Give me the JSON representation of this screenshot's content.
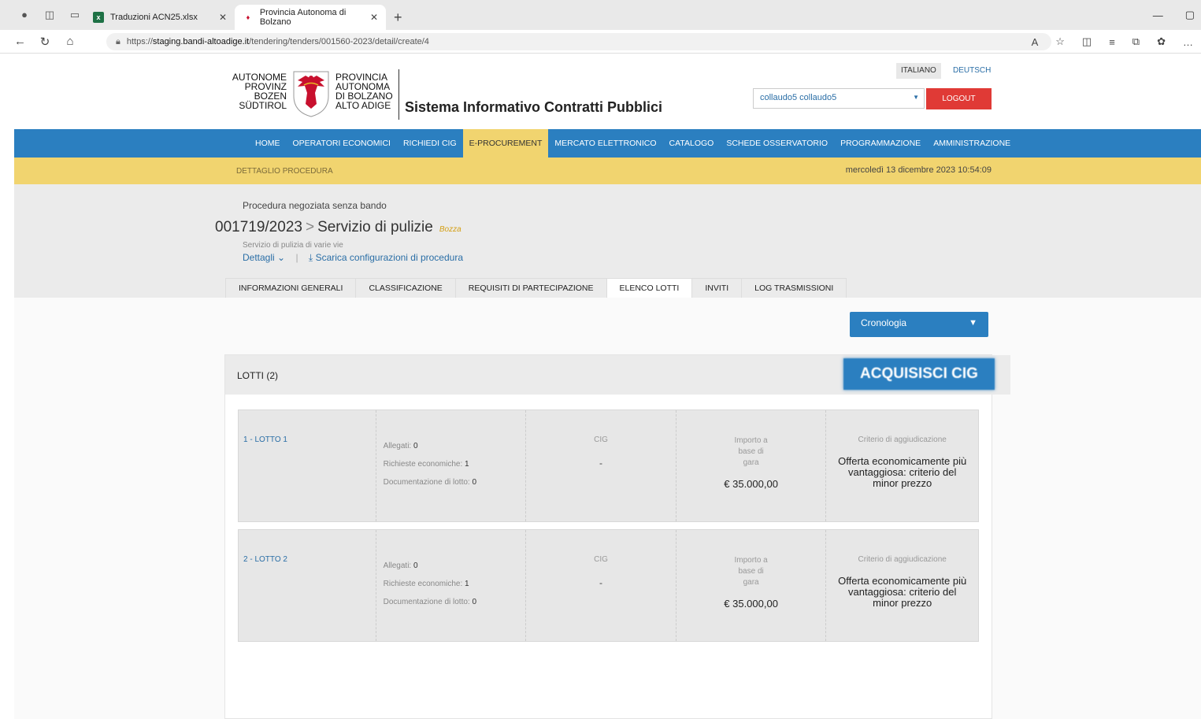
{
  "browser": {
    "tabs": [
      {
        "title": "Traduzioni ACN25.xlsx",
        "icon": "excel-icon"
      },
      {
        "title": "Provincia Autonoma di Bolzano",
        "icon": "eagle-icon"
      }
    ],
    "url_prefix": "https://",
    "url_host": "staging.bandi-altoadige.it",
    "url_path": "/tendering/tenders/001560-2023/detail/create/4"
  },
  "header": {
    "logo_left": [
      "AUTONOME",
      "PROVINZ",
      "BOZEN",
      "SÜDTIROL"
    ],
    "logo_right": [
      "PROVINCIA",
      "AUTONOMA",
      "DI BOLZANO",
      "ALTO ADIGE"
    ],
    "system_title": "Sistema Informativo Contratti Pubblici",
    "lang_it": "ITALIANO",
    "lang_de": "DEUTSCH",
    "user": "collaudo5 collaudo5",
    "logout": "LOGOUT"
  },
  "nav": {
    "items": [
      "HOME",
      "OPERATORI ECONOMICI",
      "RICHIEDI CIG",
      "E-PROCUREMENT",
      "MERCATO ELETTRONICO",
      "CATALOGO",
      "SCHEDE OSSERVATORIO",
      "PROGRAMMAZIONE",
      "AMMINISTRAZIONE"
    ],
    "active": "E-PROCUREMENT"
  },
  "subbar": {
    "crumb": "DETTAGLIO PROCEDURA",
    "datetime": "mercoledì 13 dicembre 2023 10:54:09"
  },
  "procedure": {
    "type": "Procedura negoziata senza bando",
    "code": "001719/2023",
    "separator": ">",
    "name": "Servizio di pulizie",
    "status": "Bozza",
    "description": "Servizio di pulizia di varie vie",
    "details_link": "Dettagli",
    "download_link": "Scarica configurazioni di procedura",
    "tabs": [
      "INFORMAZIONI GENERALI",
      "CLASSIFICAZIONE",
      "REQUISITI DI PARTECIPAZIONE",
      "ELENCO LOTTI",
      "INVITI",
      "LOG TRASMISSIONI"
    ],
    "active_tab": "ELENCO LOTTI"
  },
  "cronologia": "Cronologia",
  "lotti": {
    "heading": "LOTTI (2)",
    "acquire_button": "ACQUISISCI CIG",
    "labels": {
      "allegati": "Allegati:",
      "richieste": "Richieste economiche:",
      "documentazione": "Documentazione di lotto:",
      "cig": "CIG",
      "importo": [
        "Importo a",
        "base di",
        "gara"
      ],
      "criterio": "Criterio di aggiudicazione"
    },
    "items": [
      {
        "name": "1 - LOTTO 1",
        "allegati": "0",
        "richieste": "1",
        "documentazione": "0",
        "cig": "-",
        "importo": "€ 35.000,00",
        "criterio": "Offerta economicamente più vantaggiosa: criterio del minor prezzo"
      },
      {
        "name": "2 - LOTTO 2",
        "allegati": "0",
        "richieste": "1",
        "documentazione": "0",
        "cig": "-",
        "importo": "€ 35.000,00",
        "criterio": "Offerta economicamente più vantaggiosa: criterio del minor prezzo"
      }
    ]
  },
  "colors": {
    "nav_blue": "#2b7fc0",
    "yellow_band": "#f1d46f",
    "logout_red": "#e03a36"
  }
}
